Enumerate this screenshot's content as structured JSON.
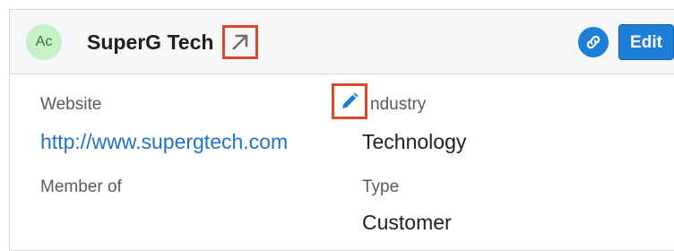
{
  "record": {
    "avatar_initials": "Ac",
    "name": "SuperG Tech"
  },
  "actions": {
    "edit_label": "Edit"
  },
  "fields": {
    "website_label": "Website",
    "website_value": "http://www.supergtech.com",
    "industry_label": "ndustry",
    "industry_value": "Technology",
    "member_of_label": "Member of",
    "member_of_value": "",
    "type_label": "Type",
    "type_value": "Customer"
  },
  "icons": {
    "external_link": "arrow-up-right-icon",
    "copy_link": "link-icon",
    "inline_edit": "pencil-icon"
  },
  "colors": {
    "accent": "#1d7ed6",
    "highlight": "#d9472f",
    "avatar_bg": "#c6f0c8",
    "link": "#1f73c4"
  }
}
